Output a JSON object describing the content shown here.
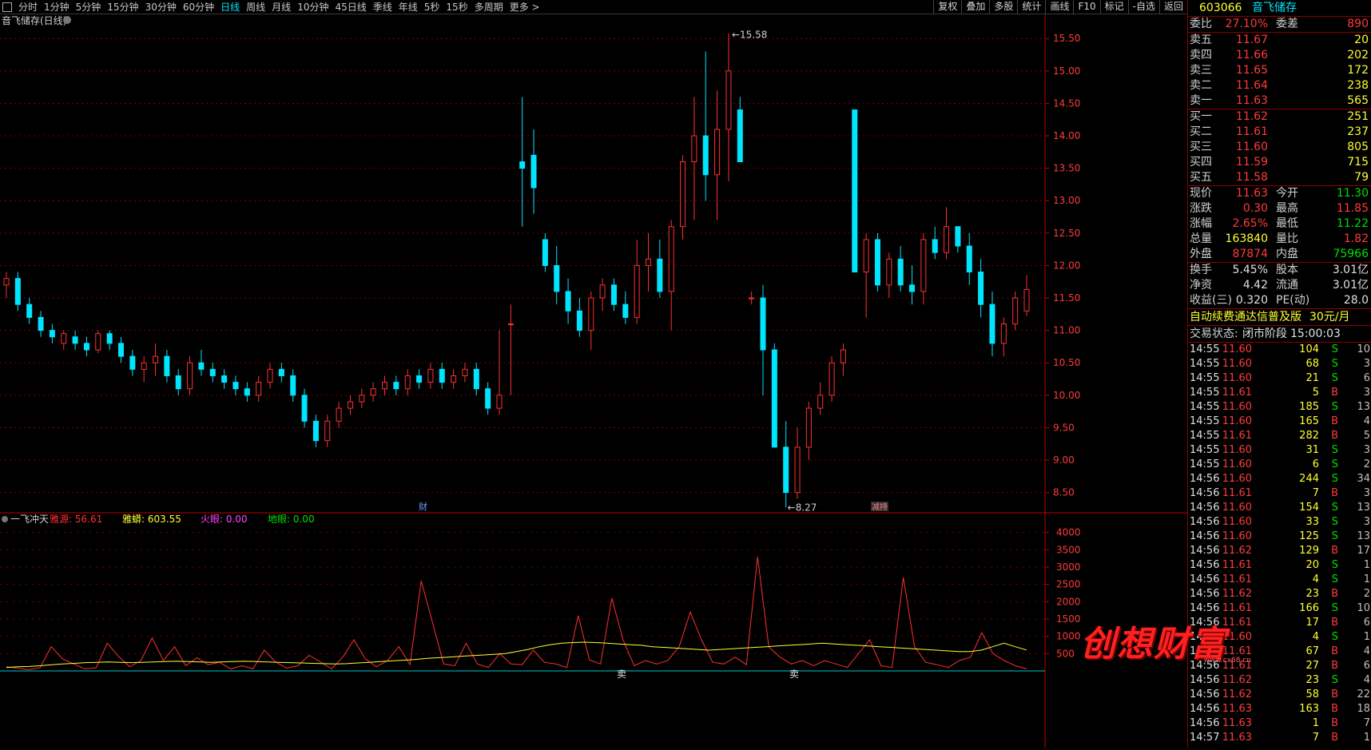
{
  "toolbar": {
    "periods": [
      "分时",
      "1分钟",
      "5分钟",
      "15分钟",
      "30分钟",
      "60分钟",
      "日线",
      "周线",
      "月线",
      "10分钟",
      "45日线",
      "季线",
      "年线",
      "5秒",
      "15秒",
      "多周期",
      "更多"
    ],
    "active_period": "日线",
    "right_buttons": [
      "复权",
      "叠加",
      "多股",
      "统计",
      "画线",
      "F10",
      "标记",
      "-自选",
      "返回"
    ]
  },
  "main_chart": {
    "title": "音飞储存(日线)",
    "high_label": "15.58",
    "low_label": "8.27",
    "marker_cai": "财",
    "marker_jian": "减持",
    "y_ticks": [
      "15.50",
      "15.00",
      "14.50",
      "14.00",
      "13.50",
      "13.00",
      "12.50",
      "12.00",
      "11.50",
      "11.00",
      "10.50",
      "10.00",
      "9.50",
      "9.00",
      "8.50"
    ]
  },
  "indicator": {
    "name": "一飞冲天",
    "items": [
      {
        "label": "雅源: ",
        "value": "56.61",
        "color": "#ff3030"
      },
      {
        "label": "雅蟒: ",
        "value": "603.55",
        "color": "#ffff33"
      },
      {
        "label": "火眼: ",
        "value": "0.00",
        "color": "#ff44ff"
      },
      {
        "label": "地眼: ",
        "value": "0.00",
        "color": "#00e000"
      }
    ],
    "y_ticks": [
      "4000",
      "3500",
      "3000",
      "2500",
      "2000",
      "1500",
      "1000",
      "500"
    ],
    "sell_label_1": "卖",
    "sell_label_2": "卖"
  },
  "quote": {
    "code": "603066",
    "name": "音飞储存",
    "weibi_label": "委比",
    "weibi": "27.10%",
    "weicha_label": "委差",
    "weicha": "890",
    "asks": [
      {
        "label": "卖五",
        "price": "11.67",
        "vol": "20"
      },
      {
        "label": "卖四",
        "price": "11.66",
        "vol": "202"
      },
      {
        "label": "卖三",
        "price": "11.65",
        "vol": "172"
      },
      {
        "label": "卖二",
        "price": "11.64",
        "vol": "238"
      },
      {
        "label": "卖一",
        "price": "11.63",
        "vol": "565"
      }
    ],
    "bids": [
      {
        "label": "买一",
        "price": "11.62",
        "vol": "251"
      },
      {
        "label": "买二",
        "price": "11.61",
        "vol": "237"
      },
      {
        "label": "买三",
        "price": "11.60",
        "vol": "805"
      },
      {
        "label": "买四",
        "price": "11.59",
        "vol": "715"
      },
      {
        "label": "买五",
        "price": "11.58",
        "vol": "79"
      }
    ],
    "stats": [
      {
        "l1": "现价",
        "v1": "11.63",
        "c1": "red",
        "l2": "今开",
        "v2": "11.30",
        "c2": "green"
      },
      {
        "l1": "涨跌",
        "v1": "0.30",
        "c1": "red",
        "l2": "最高",
        "v2": "11.85",
        "c2": "red"
      },
      {
        "l1": "涨幅",
        "v1": "2.65%",
        "c1": "red",
        "l2": "最低",
        "v2": "11.22",
        "c2": "green"
      },
      {
        "l1": "总量",
        "v1": "163840",
        "c1": "yellow",
        "l2": "量比",
        "v2": "1.82",
        "c2": "red"
      },
      {
        "l1": "外盘",
        "v1": "87874",
        "c1": "red",
        "l2": "内盘",
        "v2": "75966",
        "c2": "green"
      }
    ],
    "stats2": [
      {
        "l1": "换手",
        "v1": "5.45%",
        "l2": "股本",
        "v2": "3.01亿"
      },
      {
        "l1": "净资",
        "v1": "4.42",
        "l2": "流通",
        "v2": "3.01亿"
      },
      {
        "l1": "收益(三)",
        "v1": "0.320",
        "l2": "PE(动)",
        "v2": "28.0"
      }
    ],
    "promo": "自动续费通达信普及版",
    "promo_price": "30元/月",
    "trade_state_label": "交易状态:",
    "trade_state": "闭市阶段",
    "trade_time": "15:00:03"
  },
  "ticks": [
    {
      "t": "14:55",
      "p": "11.60",
      "v": "104",
      "s": "S",
      "n": "10"
    },
    {
      "t": "14:55",
      "p": "11.60",
      "v": "68",
      "s": "S",
      "n": "3"
    },
    {
      "t": "14:55",
      "p": "11.60",
      "v": "21",
      "s": "S",
      "n": "6"
    },
    {
      "t": "14:55",
      "p": "11.61",
      "v": "5",
      "s": "B",
      "n": "3"
    },
    {
      "t": "14:55",
      "p": "11.60",
      "v": "185",
      "s": "S",
      "n": "13"
    },
    {
      "t": "14:55",
      "p": "11.60",
      "v": "165",
      "s": "B",
      "n": "4"
    },
    {
      "t": "14:55",
      "p": "11.61",
      "v": "282",
      "s": "B",
      "n": "5"
    },
    {
      "t": "14:55",
      "p": "11.60",
      "v": "31",
      "s": "S",
      "n": "3"
    },
    {
      "t": "14:55",
      "p": "11.60",
      "v": "6",
      "s": "S",
      "n": "2"
    },
    {
      "t": "14:56",
      "p": "11.60",
      "v": "244",
      "s": "S",
      "n": "34"
    },
    {
      "t": "14:56",
      "p": "11.61",
      "v": "7",
      "s": "B",
      "n": "3"
    },
    {
      "t": "14:56",
      "p": "11.60",
      "v": "154",
      "s": "S",
      "n": "13"
    },
    {
      "t": "14:56",
      "p": "11.60",
      "v": "33",
      "s": "S",
      "n": "3"
    },
    {
      "t": "14:56",
      "p": "11.60",
      "v": "125",
      "s": "S",
      "n": "13"
    },
    {
      "t": "14:56",
      "p": "11.62",
      "v": "129",
      "s": "B",
      "n": "17"
    },
    {
      "t": "14:56",
      "p": "11.61",
      "v": "20",
      "s": "S",
      "n": "1"
    },
    {
      "t": "14:56",
      "p": "11.61",
      "v": "4",
      "s": "S",
      "n": "1"
    },
    {
      "t": "14:56",
      "p": "11.62",
      "v": "23",
      "s": "B",
      "n": "2"
    },
    {
      "t": "14:56",
      "p": "11.61",
      "v": "166",
      "s": "S",
      "n": "10"
    },
    {
      "t": "14:56",
      "p": "11.61",
      "v": "17",
      "s": "B",
      "n": "6"
    },
    {
      "t": "14:56",
      "p": "11.60",
      "v": "4",
      "s": "S",
      "n": "1"
    },
    {
      "t": "14:56",
      "p": "11.61",
      "v": "67",
      "s": "B",
      "n": "4"
    },
    {
      "t": "14:56",
      "p": "11.61",
      "v": "27",
      "s": "B",
      "n": "6"
    },
    {
      "t": "14:56",
      "p": "11.62",
      "v": "23",
      "s": "S",
      "n": "4"
    },
    {
      "t": "14:56",
      "p": "11.62",
      "v": "58",
      "s": "B",
      "n": "22"
    },
    {
      "t": "14:56",
      "p": "11.63",
      "v": "163",
      "s": "B",
      "n": "18"
    },
    {
      "t": "14:56",
      "p": "11.63",
      "v": "1",
      "s": "B",
      "n": "7"
    },
    {
      "t": "14:57",
      "p": "11.63",
      "v": "7",
      "s": "B",
      "n": "1"
    }
  ],
  "watermark": "创想财富",
  "watermark_url": "www.cx68.cn",
  "colors": {
    "up": "#ff3030",
    "down": "#00e5ff",
    "grid": "#7a0000",
    "axis": "#c00000"
  },
  "chart_data": [
    {
      "type": "candlestick",
      "title": "音飞储存(日线)",
      "y_range": [
        8.2,
        15.7
      ],
      "high": 15.58,
      "low": 8.27,
      "ohlc": [
        [
          11.7,
          11.9,
          11.5,
          11.8
        ],
        [
          11.8,
          11.9,
          11.3,
          11.4
        ],
        [
          11.4,
          11.5,
          11.1,
          11.2
        ],
        [
          11.2,
          11.3,
          10.9,
          11.0
        ],
        [
          11.0,
          11.1,
          10.8,
          10.9
        ],
        [
          10.8,
          11.0,
          10.7,
          10.95
        ],
        [
          10.9,
          11.0,
          10.7,
          10.8
        ],
        [
          10.8,
          10.9,
          10.6,
          10.7
        ],
        [
          10.7,
          11.0,
          10.65,
          10.95
        ],
        [
          10.95,
          11.0,
          10.7,
          10.8
        ],
        [
          10.8,
          10.9,
          10.5,
          10.6
        ],
        [
          10.6,
          10.7,
          10.3,
          10.4
        ],
        [
          10.4,
          10.6,
          10.2,
          10.5
        ],
        [
          10.5,
          10.8,
          10.3,
          10.6
        ],
        [
          10.6,
          10.7,
          10.2,
          10.3
        ],
        [
          10.3,
          10.4,
          10.0,
          10.1
        ],
        [
          10.1,
          10.6,
          10.0,
          10.5
        ],
        [
          10.5,
          10.7,
          10.3,
          10.4
        ],
        [
          10.4,
          10.5,
          10.2,
          10.3
        ],
        [
          10.3,
          10.4,
          10.1,
          10.2
        ],
        [
          10.2,
          10.3,
          10.0,
          10.1
        ],
        [
          10.1,
          10.2,
          9.9,
          10.0
        ],
        [
          10.0,
          10.3,
          9.9,
          10.2
        ],
        [
          10.2,
          10.5,
          10.1,
          10.4
        ],
        [
          10.4,
          10.5,
          10.2,
          10.3
        ],
        [
          10.3,
          10.4,
          9.9,
          10.0
        ],
        [
          10.0,
          10.1,
          9.5,
          9.6
        ],
        [
          9.6,
          9.7,
          9.2,
          9.3
        ],
        [
          9.3,
          9.7,
          9.2,
          9.6
        ],
        [
          9.6,
          9.9,
          9.5,
          9.8
        ],
        [
          9.8,
          10.0,
          9.7,
          9.9
        ],
        [
          9.9,
          10.1,
          9.8,
          10.0
        ],
        [
          10.0,
          10.2,
          9.9,
          10.1
        ],
        [
          10.1,
          10.3,
          10.0,
          10.2
        ],
        [
          10.2,
          10.3,
          10.0,
          10.1
        ],
        [
          10.1,
          10.4,
          10.0,
          10.3
        ],
        [
          10.3,
          10.4,
          10.1,
          10.2
        ],
        [
          10.2,
          10.5,
          10.1,
          10.4
        ],
        [
          10.4,
          10.5,
          10.1,
          10.2
        ],
        [
          10.2,
          10.4,
          10.1,
          10.3
        ],
        [
          10.3,
          10.5,
          10.2,
          10.4
        ],
        [
          10.4,
          10.5,
          10.0,
          10.1
        ],
        [
          10.1,
          10.2,
          9.7,
          9.8
        ],
        [
          9.8,
          11.0,
          9.7,
          10.0
        ],
        [
          11.1,
          11.4,
          10.0,
          11.1
        ],
        [
          13.6,
          14.6,
          12.6,
          13.5
        ],
        [
          13.7,
          14.1,
          12.8,
          13.2
        ],
        [
          12.4,
          12.5,
          11.9,
          12.0
        ],
        [
          12.0,
          12.3,
          11.4,
          11.6
        ],
        [
          11.6,
          11.8,
          11.1,
          11.3
        ],
        [
          11.3,
          11.5,
          10.9,
          11.0
        ],
        [
          11.0,
          11.6,
          10.7,
          11.5
        ],
        [
          11.5,
          11.8,
          11.3,
          11.7
        ],
        [
          11.7,
          11.8,
          11.3,
          11.4
        ],
        [
          11.4,
          11.6,
          11.1,
          11.2
        ],
        [
          11.2,
          12.4,
          11.1,
          12.0
        ],
        [
          12.0,
          12.5,
          11.6,
          12.1
        ],
        [
          12.1,
          12.4,
          11.5,
          11.6
        ],
        [
          11.6,
          12.7,
          11.0,
          12.6
        ],
        [
          12.6,
          13.7,
          12.4,
          13.6
        ],
        [
          13.6,
          14.6,
          12.7,
          14.0
        ],
        [
          14.0,
          15.3,
          13.0,
          13.4
        ],
        [
          13.4,
          14.7,
          12.7,
          14.1
        ],
        [
          14.1,
          15.58,
          13.3,
          15.0
        ],
        [
          14.4,
          14.6,
          13.6,
          13.6
        ],
        [
          11.5,
          11.6,
          11.4,
          11.5
        ],
        [
          11.5,
          11.7,
          10.0,
          10.7
        ],
        [
          10.7,
          10.8,
          9.4,
          9.2
        ],
        [
          9.2,
          9.6,
          8.27,
          8.5
        ],
        [
          8.5,
          9.5,
          8.4,
          9.2
        ],
        [
          9.2,
          9.9,
          9.0,
          9.8
        ],
        [
          9.8,
          10.2,
          9.7,
          10.0
        ],
        [
          10.0,
          10.6,
          9.9,
          10.5
        ],
        [
          10.5,
          10.8,
          10.3,
          10.7
        ],
        [
          14.4,
          14.4,
          11.9,
          11.9
        ],
        [
          11.9,
          12.5,
          11.2,
          12.4
        ],
        [
          12.4,
          12.5,
          11.6,
          11.7
        ],
        [
          11.7,
          12.2,
          11.5,
          12.1
        ],
        [
          12.1,
          12.3,
          11.6,
          11.7
        ],
        [
          11.7,
          12.0,
          11.4,
          11.6
        ],
        [
          11.6,
          12.5,
          11.4,
          12.4
        ],
        [
          12.4,
          12.6,
          12.1,
          12.2
        ],
        [
          12.2,
          12.9,
          12.1,
          12.6
        ],
        [
          12.6,
          12.6,
          12.2,
          12.3
        ],
        [
          12.3,
          12.5,
          11.7,
          11.9
        ],
        [
          11.9,
          12.1,
          11.2,
          11.4
        ],
        [
          11.4,
          11.6,
          10.6,
          10.8
        ],
        [
          10.8,
          11.2,
          10.6,
          11.1
        ],
        [
          11.1,
          11.6,
          11.0,
          11.5
        ],
        [
          11.3,
          11.85,
          11.22,
          11.63
        ]
      ]
    },
    {
      "type": "line",
      "title": "一飞冲天",
      "y_range": [
        0,
        4200
      ],
      "series": [
        {
          "name": "雅源",
          "color": "#ff3030",
          "values": [
            120,
            80,
            40,
            90,
            700,
            350,
            200,
            60,
            90,
            800,
            420,
            120,
            300,
            950,
            300,
            700,
            150,
            380,
            180,
            250,
            60,
            150,
            60,
            600,
            260,
            80,
            150,
            450,
            260,
            60,
            400,
            900,
            350,
            120,
            300,
            700,
            180,
            2600,
            1400,
            200,
            150,
            800,
            200,
            100,
            500,
            200,
            180,
            600,
            250,
            200,
            100,
            1600,
            320,
            200,
            2100,
            900,
            150,
            300,
            200,
            300,
            700,
            1700,
            900,
            250,
            200,
            400,
            180,
            3300,
            700,
            400,
            200,
            300,
            150,
            300,
            200,
            100,
            500,
            900,
            150,
            100,
            2700,
            700,
            250,
            180,
            100,
            300,
            400,
            1100,
            500,
            300,
            150,
            56.61
          ]
        },
        {
          "name": "雅蟒",
          "color": "#ffff33",
          "values": [
            100,
            120,
            130,
            150,
            180,
            200,
            220,
            240,
            250,
            260,
            250,
            240,
            250,
            260,
            270,
            280,
            270,
            260,
            250,
            260,
            270,
            280,
            270,
            260,
            250,
            240,
            230,
            220,
            210,
            200,
            210,
            230,
            250,
            270,
            290,
            310,
            330,
            360,
            380,
            400,
            420,
            440,
            460,
            480,
            500,
            560,
            620,
            700,
            760,
            800,
            820,
            830,
            820,
            800,
            780,
            760,
            740,
            700,
            680,
            660,
            640,
            620,
            600,
            620,
            640,
            660,
            680,
            700,
            720,
            740,
            760,
            780,
            800,
            780,
            760,
            740,
            720,
            700,
            680,
            660,
            640,
            620,
            600,
            580,
            560,
            560,
            600,
            700,
            800,
            700,
            603.55
          ]
        }
      ]
    }
  ]
}
